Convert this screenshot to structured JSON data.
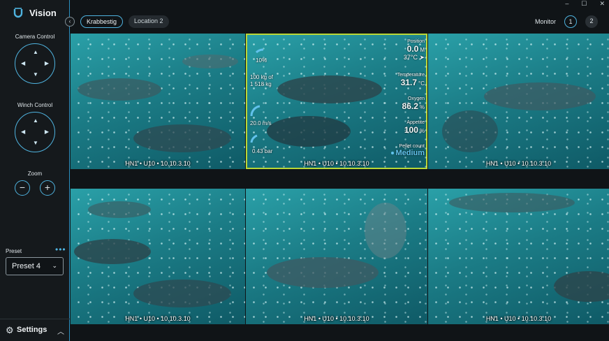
{
  "app": {
    "name": "Vision"
  },
  "window_controls": [
    "–",
    "☐",
    "✕"
  ],
  "sidebar": {
    "camera_control_label": "Camera Control",
    "winch_control_label": "Winch Control",
    "zoom_label": "Zoom",
    "zoom_out": "−",
    "zoom_in": "+",
    "preset_label": "Preset",
    "preset_more": "•••",
    "preset_value": "Preset 4",
    "settings_label": "Settings"
  },
  "topbar": {
    "locations": [
      {
        "label": "Krabbestig",
        "active": true
      },
      {
        "label": "Location 2",
        "active": false
      }
    ],
    "monitor_label": "Monitor",
    "monitors": [
      "1",
      "2"
    ]
  },
  "cameras": [
    {
      "caption": "HN1 • U10 • 10.10.3.10"
    },
    {
      "caption": "HN1 • U10 • 10.10.3.10",
      "selected": true
    },
    {
      "caption": "HN1 • U10 • 10.10.3.10"
    },
    {
      "caption": "HN1 • U10 • 10.10.3.10"
    },
    {
      "caption": "HN1 • U10 • 10.10.3.10"
    },
    {
      "caption": "HN1 • U10 • 10.10.3.10"
    }
  ],
  "overlay": {
    "gauge_percent_label": "10%",
    "gauge_percent_value": 10,
    "biomass": "100 kg of",
    "biomass_total": "1 518 kg",
    "speed": "20.0 m/s",
    "pressure": "0.43 bar",
    "position_label": "Position",
    "position_value": "0.0",
    "position_unit": "M",
    "heading_value": "37°C",
    "temperature_label": "Temperature",
    "temperature_value": "31.7",
    "temperature_unit": "°C",
    "oxygen_label": "Oxygen",
    "oxygen_value": "86.2",
    "oxygen_unit": "%",
    "appetite_label": "Appetite",
    "appetite_value": "100",
    "appetite_unit": "%",
    "pellet_label": "Pellet count",
    "pellet_value": "Medium"
  },
  "colors": {
    "accent": "#4fb3df",
    "selected_outline": "#b9d737",
    "water": "#1b7c86"
  }
}
